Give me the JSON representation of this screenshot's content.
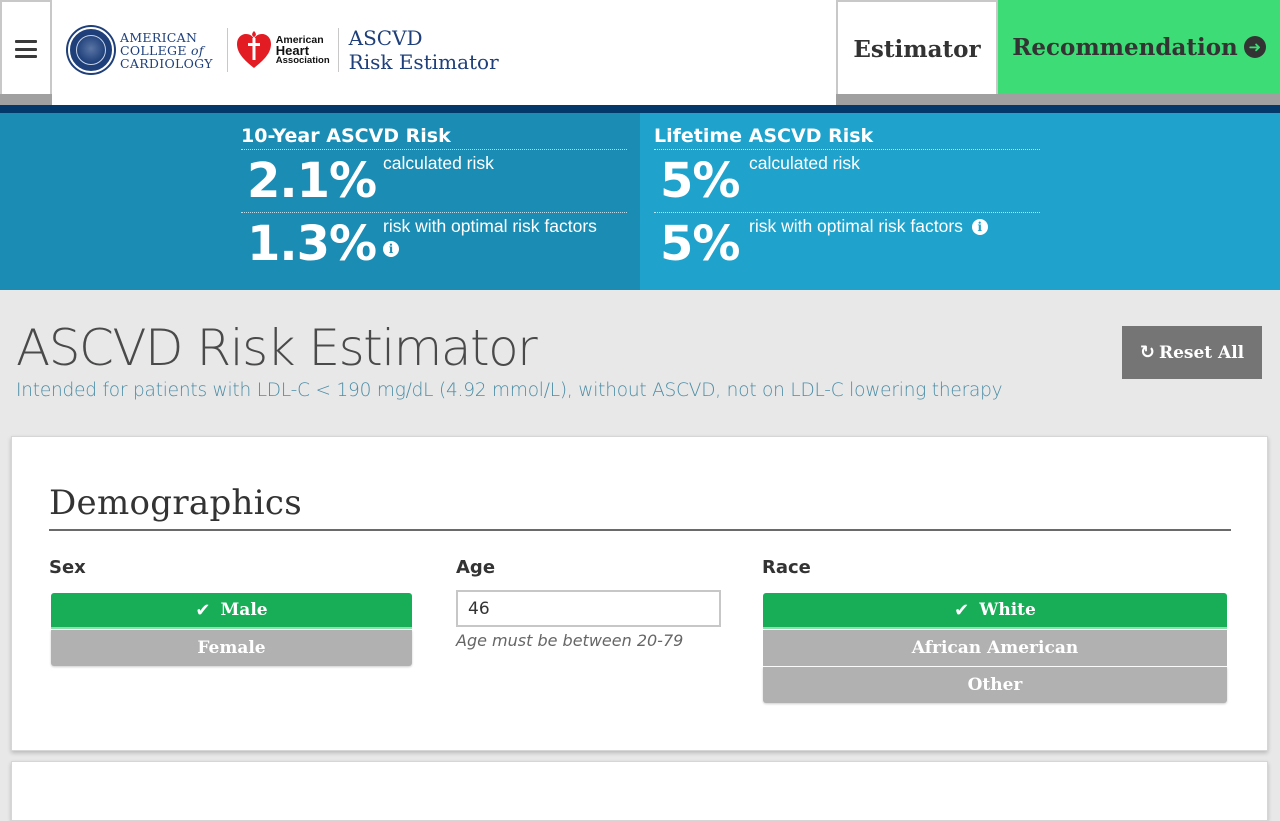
{
  "header": {
    "menu_icon": "hamburger-icon",
    "logos": {
      "acc": [
        "AMERICAN",
        "COLLEGE",
        "of",
        "CARDIOLOGY"
      ],
      "aha": [
        "American",
        "Heart",
        "Association"
      ],
      "brand": [
        "ASCVD",
        "Risk Estimator"
      ]
    },
    "tabs": {
      "estimator": "Estimator",
      "recommendation": "Recommendation",
      "recommendation_icon": "arrow-circle-right-icon"
    }
  },
  "risk": {
    "ten_year": {
      "title": "10-Year ASCVD Risk",
      "calculated_value": "2.1%",
      "calculated_label": "calculated risk",
      "optimal_value": "1.3%",
      "optimal_label": "risk with optimal risk factors"
    },
    "lifetime": {
      "title": "Lifetime ASCVD Risk",
      "calculated_value": "5%",
      "calculated_label": "calculated risk",
      "optimal_value": "5%",
      "optimal_label": "risk with optimal risk factors"
    },
    "info_glyph": "i"
  },
  "page": {
    "title": "ASCVD Risk Estimator",
    "subtitle": "Intended for patients with LDL-C < 190 mg/dL (4.92 mmol/L), without ASCVD, not on LDL-C lowering therapy",
    "reset_label": "Reset All",
    "reset_icon": "↻"
  },
  "demographics": {
    "title": "Demographics",
    "sex": {
      "label": "Sex",
      "options": [
        "Male",
        "Female"
      ],
      "selected": "Male"
    },
    "age": {
      "label": "Age",
      "value": "46",
      "hint": "Age must be between 20-79"
    },
    "race": {
      "label": "Race",
      "options": [
        "White",
        "African American",
        "Other"
      ],
      "selected": "White"
    },
    "check_glyph": "✔"
  },
  "colors": {
    "accent_green": "#3ddc76",
    "selected_green": "#18ae58",
    "navy": "#03386b",
    "risk_blue_dark": "#1b8db5",
    "risk_blue_light": "#1fa3cc"
  }
}
